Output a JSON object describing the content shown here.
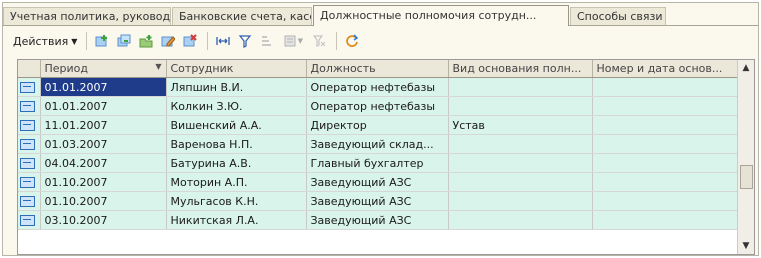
{
  "tabs": [
    {
      "label": "Учетная политика, руководители",
      "active": false
    },
    {
      "label": "Банковские счета, касса",
      "active": false
    },
    {
      "label": "Должностные полномочия сотрудн...",
      "active": true
    },
    {
      "label": "Способы связи",
      "active": false
    }
  ],
  "toolbar": {
    "actions_label": "Действия",
    "buttons": [
      "add-icon",
      "copy-icon",
      "add-group-icon",
      "edit-icon",
      "delete-icon",
      "select-icon",
      "filter-icon",
      "sort-icon",
      "filter-dropdown-icon",
      "clear-filter-icon",
      "refresh-icon"
    ]
  },
  "grid": {
    "columns": [
      "Период",
      "Сотрудник",
      "Должность",
      "Вид основания полн...",
      "Номер и дата основ..."
    ],
    "rows": [
      {
        "period": "01.01.2007",
        "employee": "Ляпшин В.И.",
        "position": "Оператор нефтебазы",
        "basis": "",
        "number": "",
        "selected": true
      },
      {
        "period": "01.01.2007",
        "employee": "Колкин З.Ю.",
        "position": "Оператор нефтебазы",
        "basis": "",
        "number": ""
      },
      {
        "period": "11.01.2007",
        "employee": "Вишенский А.А.",
        "position": "Директор",
        "basis": "Устав",
        "number": ""
      },
      {
        "period": "01.03.2007",
        "employee": "Варенова Н.П.",
        "position": "Заведующий склад...",
        "basis": "",
        "number": ""
      },
      {
        "period": "04.04.2007",
        "employee": "Батурина А.В.",
        "position": "Главный бухгалтер",
        "basis": "",
        "number": ""
      },
      {
        "period": "01.10.2007",
        "employee": "Моторин А.П.",
        "position": "Заведующий АЗС",
        "basis": "",
        "number": ""
      },
      {
        "period": "01.10.2007",
        "employee": "Мульгасов К.Н.",
        "position": "Заведующий АЗС",
        "basis": "",
        "number": ""
      },
      {
        "period": "03.10.2007",
        "employee": "Никитская Л.А.",
        "position": "Заведующий АЗС",
        "basis": "",
        "number": ""
      }
    ]
  },
  "colors": {
    "row_bg": "#d9f4ea",
    "selected_bg": "#1e3c8a",
    "header_bg": "#ebe7d9"
  }
}
